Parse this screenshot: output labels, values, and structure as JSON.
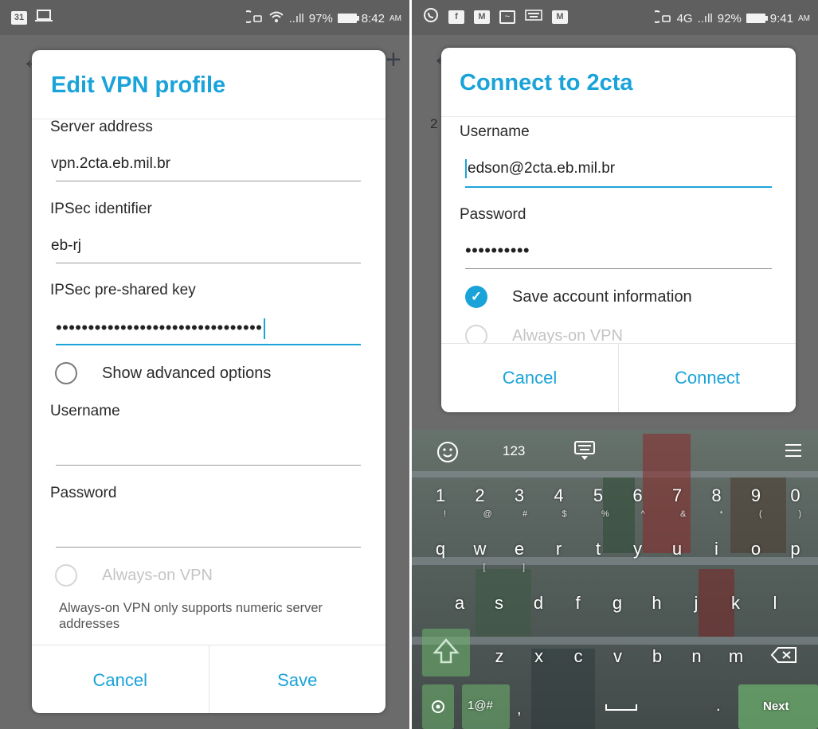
{
  "left": {
    "status": {
      "battery": "97%",
      "time": "8:42",
      "ampm": "AM",
      "signal": "..ıll",
      "calendar_day": "31"
    },
    "dialog": {
      "title": "Edit VPN profile",
      "server_address_label": "Server address",
      "server_address_value": "vpn.2cta.eb.mil.br",
      "ipsec_id_label": "IPSec identifier",
      "ipsec_id_value": "eb-rj",
      "psk_label": "IPSec pre-shared key",
      "psk_value": "••••••••••••••••••••••••••••••••",
      "advanced_label": "Show advanced options",
      "username_label": "Username",
      "username_value": "",
      "password_label": "Password",
      "password_value": "",
      "always_on_label": "Always-on VPN",
      "always_on_note": "Always-on VPN only supports numeric server addresses",
      "cancel": "Cancel",
      "save": "Save"
    }
  },
  "right": {
    "status": {
      "network": "4G",
      "battery": "92%",
      "time": "9:41",
      "ampm": "AM",
      "signal": "..ıll"
    },
    "backdrop_char": "2",
    "dialog": {
      "title": "Connect to 2cta",
      "username_label": "Username",
      "username_value": "edson@2cta.eb.mil.br",
      "password_label": "Password",
      "password_value": "••••••••••",
      "save_account_label": "Save account information",
      "always_on_label": "Always-on VPN",
      "cancel": "Cancel",
      "connect": "Connect"
    },
    "keyboard": {
      "mode_label": "123",
      "numbers": [
        "1",
        "2",
        "3",
        "4",
        "5",
        "6",
        "7",
        "8",
        "9",
        "0"
      ],
      "number_subs": [
        "!",
        "@",
        "#",
        "$",
        "%",
        "^",
        "&",
        "*",
        "(",
        ")"
      ],
      "row1": [
        "q",
        "w",
        "e",
        "r",
        "t",
        "y",
        "u",
        "i",
        "o",
        "p"
      ],
      "row1_subs": [
        "",
        "[",
        "]",
        "",
        "",
        "",
        "",
        "",
        "",
        ""
      ],
      "row2": [
        "a",
        "s",
        "d",
        "f",
        "g",
        "h",
        "j",
        "k",
        "l"
      ],
      "row3": [
        "z",
        "x",
        "c",
        "v",
        "b",
        "n",
        "m"
      ],
      "symbols_key": "1@#",
      "comma": ",",
      "period": ".",
      "next": "Next"
    }
  }
}
